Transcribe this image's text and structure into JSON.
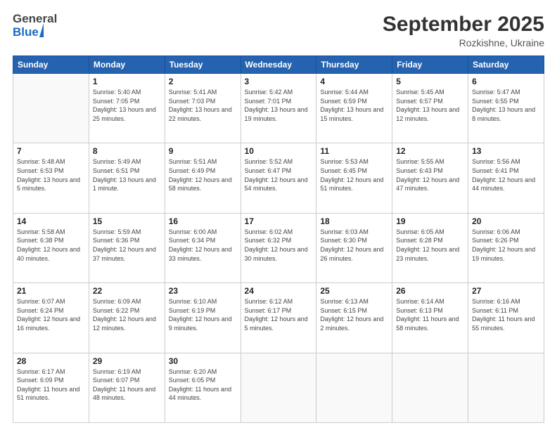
{
  "header": {
    "logo_general": "General",
    "logo_blue": "Blue",
    "month_title": "September 2025",
    "location": "Rozkishne, Ukraine"
  },
  "weekdays": [
    "Sunday",
    "Monday",
    "Tuesday",
    "Wednesday",
    "Thursday",
    "Friday",
    "Saturday"
  ],
  "weeks": [
    [
      {
        "day": "",
        "detail": ""
      },
      {
        "day": "1",
        "detail": "Sunrise: 5:40 AM\nSunset: 7:05 PM\nDaylight: 13 hours\nand 25 minutes."
      },
      {
        "day": "2",
        "detail": "Sunrise: 5:41 AM\nSunset: 7:03 PM\nDaylight: 13 hours\nand 22 minutes."
      },
      {
        "day": "3",
        "detail": "Sunrise: 5:42 AM\nSunset: 7:01 PM\nDaylight: 13 hours\nand 19 minutes."
      },
      {
        "day": "4",
        "detail": "Sunrise: 5:44 AM\nSunset: 6:59 PM\nDaylight: 13 hours\nand 15 minutes."
      },
      {
        "day": "5",
        "detail": "Sunrise: 5:45 AM\nSunset: 6:57 PM\nDaylight: 13 hours\nand 12 minutes."
      },
      {
        "day": "6",
        "detail": "Sunrise: 5:47 AM\nSunset: 6:55 PM\nDaylight: 13 hours\nand 8 minutes."
      }
    ],
    [
      {
        "day": "7",
        "detail": "Sunrise: 5:48 AM\nSunset: 6:53 PM\nDaylight: 13 hours\nand 5 minutes."
      },
      {
        "day": "8",
        "detail": "Sunrise: 5:49 AM\nSunset: 6:51 PM\nDaylight: 13 hours\nand 1 minute."
      },
      {
        "day": "9",
        "detail": "Sunrise: 5:51 AM\nSunset: 6:49 PM\nDaylight: 12 hours\nand 58 minutes."
      },
      {
        "day": "10",
        "detail": "Sunrise: 5:52 AM\nSunset: 6:47 PM\nDaylight: 12 hours\nand 54 minutes."
      },
      {
        "day": "11",
        "detail": "Sunrise: 5:53 AM\nSunset: 6:45 PM\nDaylight: 12 hours\nand 51 minutes."
      },
      {
        "day": "12",
        "detail": "Sunrise: 5:55 AM\nSunset: 6:43 PM\nDaylight: 12 hours\nand 47 minutes."
      },
      {
        "day": "13",
        "detail": "Sunrise: 5:56 AM\nSunset: 6:41 PM\nDaylight: 12 hours\nand 44 minutes."
      }
    ],
    [
      {
        "day": "14",
        "detail": "Sunrise: 5:58 AM\nSunset: 6:38 PM\nDaylight: 12 hours\nand 40 minutes."
      },
      {
        "day": "15",
        "detail": "Sunrise: 5:59 AM\nSunset: 6:36 PM\nDaylight: 12 hours\nand 37 minutes."
      },
      {
        "day": "16",
        "detail": "Sunrise: 6:00 AM\nSunset: 6:34 PM\nDaylight: 12 hours\nand 33 minutes."
      },
      {
        "day": "17",
        "detail": "Sunrise: 6:02 AM\nSunset: 6:32 PM\nDaylight: 12 hours\nand 30 minutes."
      },
      {
        "day": "18",
        "detail": "Sunrise: 6:03 AM\nSunset: 6:30 PM\nDaylight: 12 hours\nand 26 minutes."
      },
      {
        "day": "19",
        "detail": "Sunrise: 6:05 AM\nSunset: 6:28 PM\nDaylight: 12 hours\nand 23 minutes."
      },
      {
        "day": "20",
        "detail": "Sunrise: 6:06 AM\nSunset: 6:26 PM\nDaylight: 12 hours\nand 19 minutes."
      }
    ],
    [
      {
        "day": "21",
        "detail": "Sunrise: 6:07 AM\nSunset: 6:24 PM\nDaylight: 12 hours\nand 16 minutes."
      },
      {
        "day": "22",
        "detail": "Sunrise: 6:09 AM\nSunset: 6:22 PM\nDaylight: 12 hours\nand 12 minutes."
      },
      {
        "day": "23",
        "detail": "Sunrise: 6:10 AM\nSunset: 6:19 PM\nDaylight: 12 hours\nand 9 minutes."
      },
      {
        "day": "24",
        "detail": "Sunrise: 6:12 AM\nSunset: 6:17 PM\nDaylight: 12 hours\nand 5 minutes."
      },
      {
        "day": "25",
        "detail": "Sunrise: 6:13 AM\nSunset: 6:15 PM\nDaylight: 12 hours\nand 2 minutes."
      },
      {
        "day": "26",
        "detail": "Sunrise: 6:14 AM\nSunset: 6:13 PM\nDaylight: 11 hours\nand 58 minutes."
      },
      {
        "day": "27",
        "detail": "Sunrise: 6:16 AM\nSunset: 6:11 PM\nDaylight: 11 hours\nand 55 minutes."
      }
    ],
    [
      {
        "day": "28",
        "detail": "Sunrise: 6:17 AM\nSunset: 6:09 PM\nDaylight: 11 hours\nand 51 minutes."
      },
      {
        "day": "29",
        "detail": "Sunrise: 6:19 AM\nSunset: 6:07 PM\nDaylight: 11 hours\nand 48 minutes."
      },
      {
        "day": "30",
        "detail": "Sunrise: 6:20 AM\nSunset: 6:05 PM\nDaylight: 11 hours\nand 44 minutes."
      },
      {
        "day": "",
        "detail": ""
      },
      {
        "day": "",
        "detail": ""
      },
      {
        "day": "",
        "detail": ""
      },
      {
        "day": "",
        "detail": ""
      }
    ]
  ]
}
